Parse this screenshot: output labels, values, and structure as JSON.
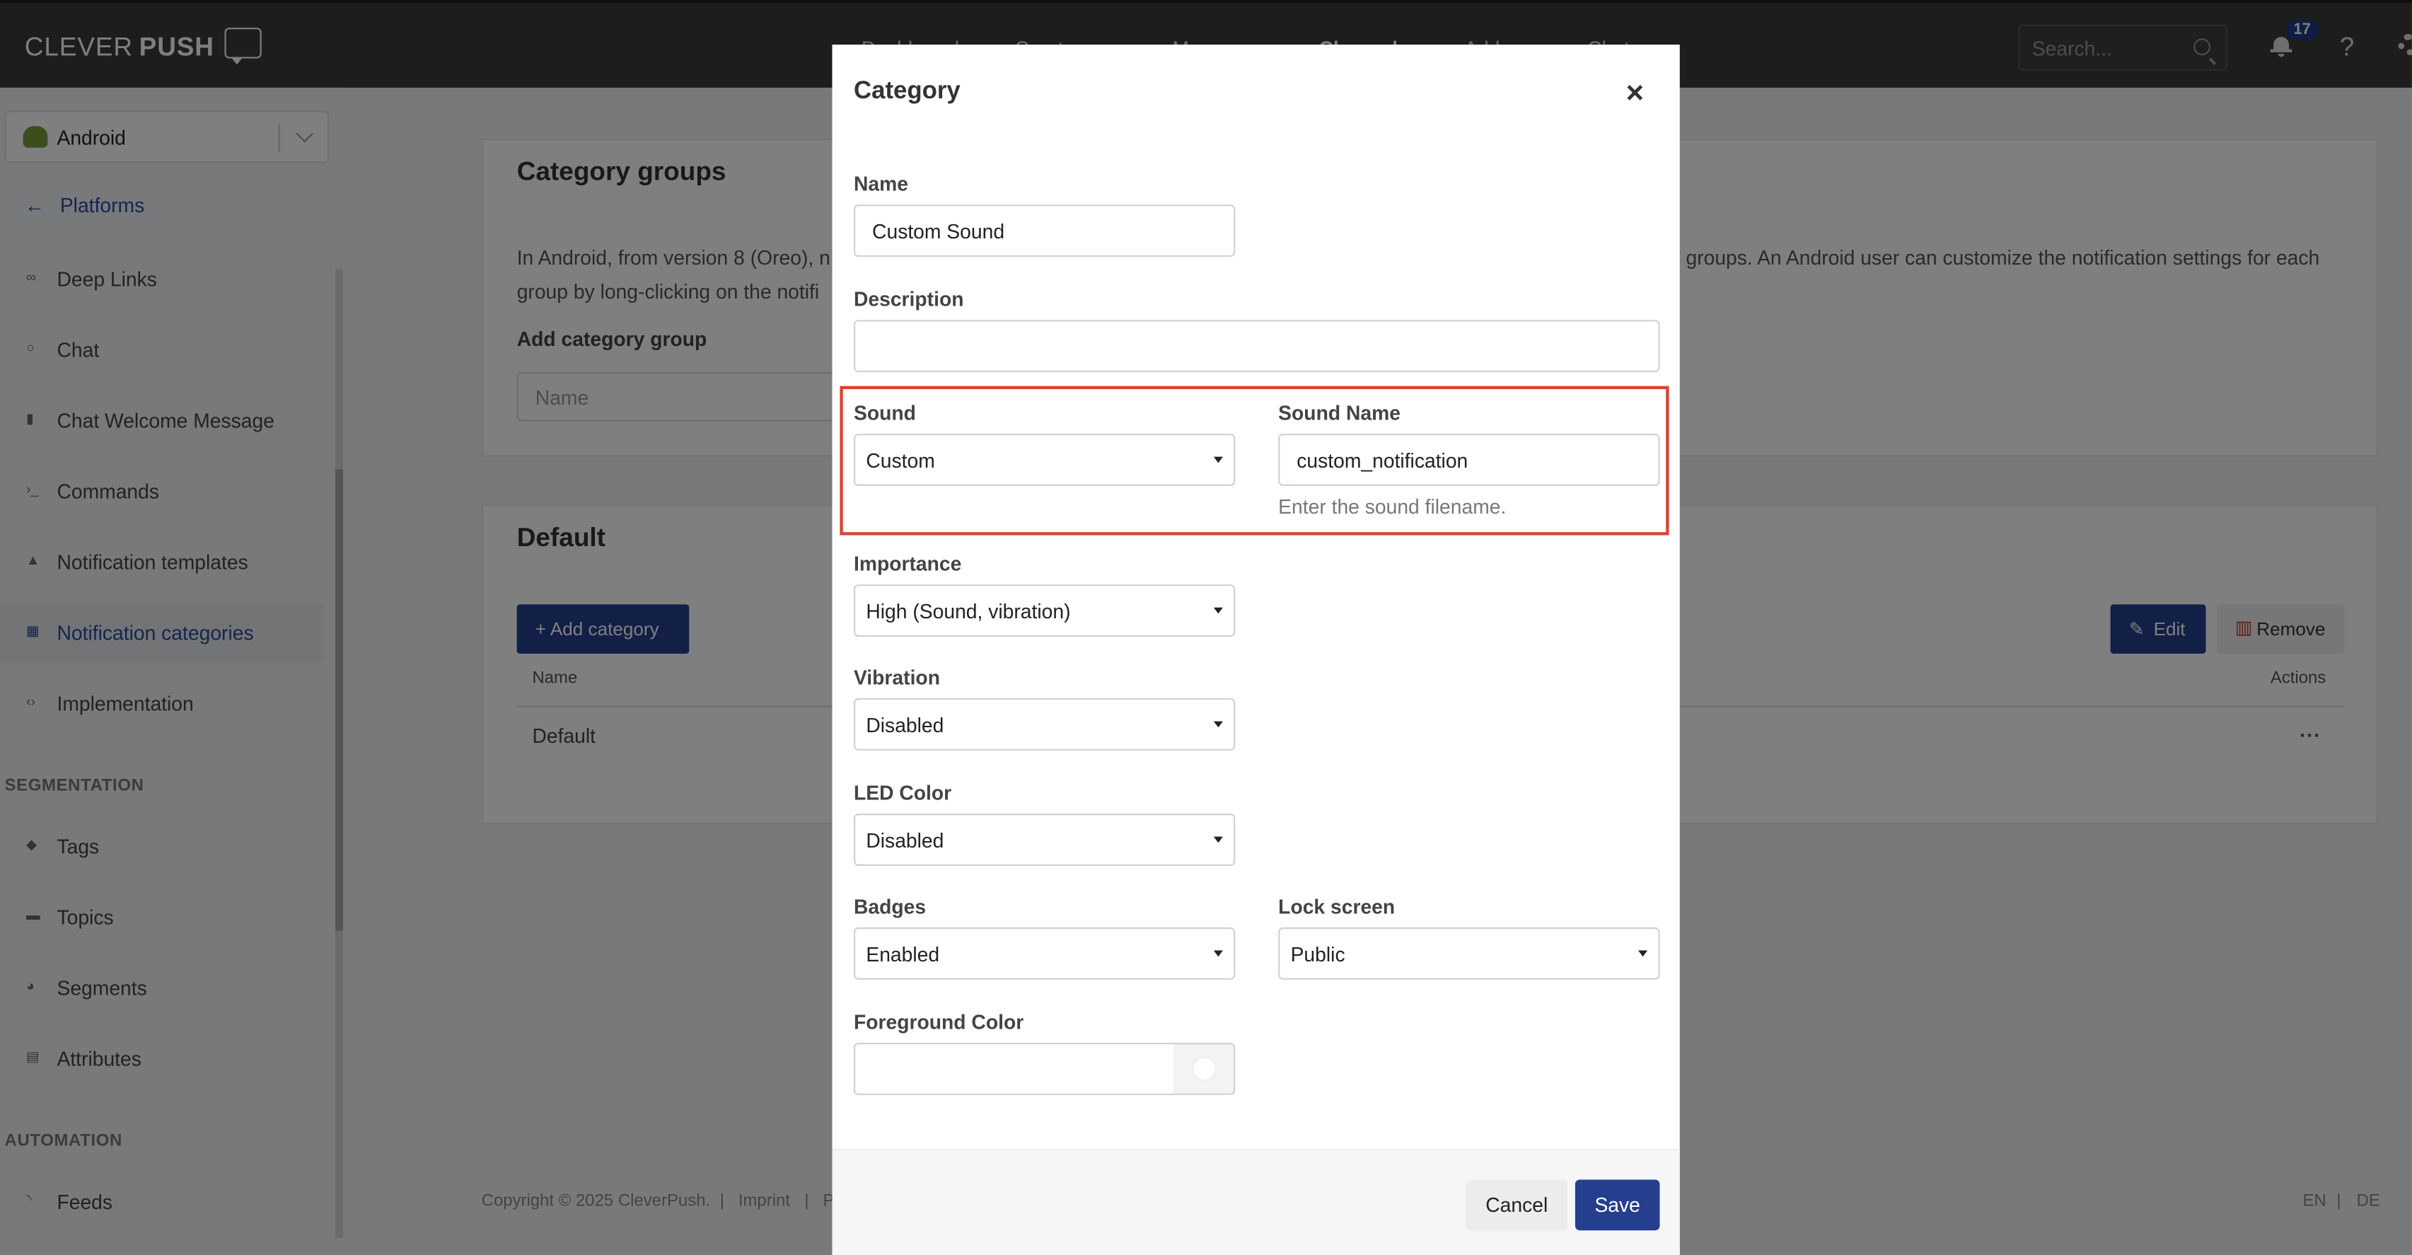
{
  "brand": {
    "name_light": "CLEVER",
    "name_bold": "PUSH"
  },
  "nav": {
    "items": [
      "Dashboard",
      "Create new",
      "Messages",
      "Channels",
      "Addons",
      "Chat"
    ],
    "active": "Channels"
  },
  "search": {
    "placeholder": "Search..."
  },
  "notifications": {
    "count": "17"
  },
  "help_label": "?",
  "sidebar": {
    "platform": "Android",
    "back_label": "Platforms",
    "items": [
      {
        "label": "Deep Links",
        "icon": "link-icon"
      },
      {
        "label": "Chat",
        "icon": "chat-icon"
      },
      {
        "label": "Chat Welcome Message",
        "icon": "message-icon"
      },
      {
        "label": "Commands",
        "icon": "terminal-icon"
      },
      {
        "label": "Notification templates",
        "icon": "bell-icon"
      },
      {
        "label": "Notification categories",
        "icon": "grid-icon"
      },
      {
        "label": "Implementation",
        "icon": "code-icon"
      }
    ],
    "section_segmentation": "SEGMENTATION",
    "segmentation_items": [
      {
        "label": "Tags",
        "icon": "tag-icon"
      },
      {
        "label": "Topics",
        "icon": "folder-icon"
      },
      {
        "label": "Segments",
        "icon": "pie-icon"
      },
      {
        "label": "Attributes",
        "icon": "database-icon"
      }
    ],
    "section_automation": "AUTOMATION",
    "automation_items": [
      {
        "label": "Feeds",
        "icon": "rss-icon"
      }
    ]
  },
  "category_groups": {
    "title": "Category groups",
    "text_line1_left": "In Android, from version 8 (Oreo), n",
    "text_line1_right": "groups. An Android user can customize the notification settings for each",
    "text_line2": "group by long-clicking on the notifi",
    "add_label": "Add category group",
    "name_placeholder": "Name"
  },
  "default_card": {
    "title": "Default",
    "add_button": "+ Add category",
    "edit_button": "Edit",
    "remove_button": "Remove",
    "col_name": "Name",
    "col_actions": "Actions",
    "row_name": "Default",
    "row_actions": "..."
  },
  "footer": {
    "copyright": "Copyright © 2025 CleverPush.",
    "sep": "|",
    "imprint": "Imprint",
    "cut": "P",
    "lang_en": "EN",
    "lang_de": "DE"
  },
  "modal": {
    "title": "Category",
    "close": "×",
    "name_label": "Name",
    "name_value": "Custom Sound",
    "description_label": "Description",
    "description_value": "",
    "sound_label": "Sound",
    "sound_value": "Custom",
    "sound_name_label": "Sound Name",
    "sound_name_value": "custom_notification",
    "sound_name_help": "Enter the sound filename.",
    "importance_label": "Importance",
    "importance_value": "High (Sound, vibration)",
    "vibration_label": "Vibration",
    "vibration_value": "Disabled",
    "led_label": "LED Color",
    "led_value": "Disabled",
    "badges_label": "Badges",
    "badges_value": "Enabled",
    "lock_label": "Lock screen",
    "lock_value": "Public",
    "fg_label": "Foreground Color",
    "fg_value": "",
    "cancel": "Cancel",
    "save": "Save"
  },
  "colors": {
    "primary": "#253f8e",
    "highlight": "#d9442f",
    "topbar": "#3b3b3b"
  }
}
